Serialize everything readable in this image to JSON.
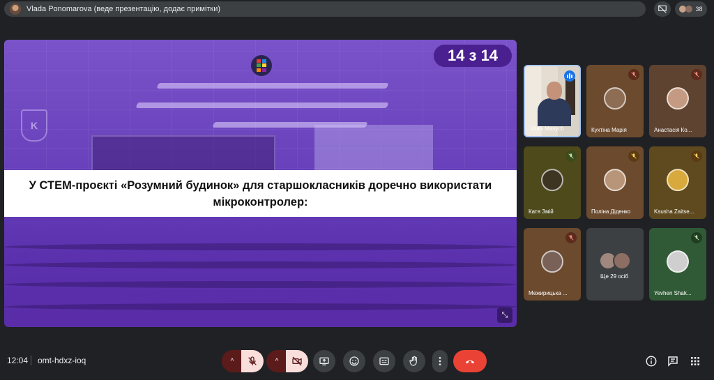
{
  "topbar": {
    "presenter_text": "Vlada Ponomarova (веде презентацію, додає примітки)",
    "participants_count": "38"
  },
  "slide": {
    "counter": "14 з 14",
    "school_logo_letters": "K",
    "question": "У СТЕМ-проєкті «Розумний будинок» для старшокласників доречно використати мікроконтролер:"
  },
  "participants": [
    {
      "name": "Vitalii Masych",
      "state": "speaking"
    },
    {
      "name": "Кухтіна Марія",
      "state": "muted"
    },
    {
      "name": "Анастасія Ко...",
      "state": "muted"
    },
    {
      "name": "Катя Змій",
      "state": "muted"
    },
    {
      "name": "Поліна Діденко",
      "state": "muted"
    },
    {
      "name": "Ksusha Zaitse...",
      "state": "muted"
    },
    {
      "name": "Межирицька ...",
      "state": "muted"
    },
    {
      "name": "Ще 29 осіб",
      "state": "group"
    },
    {
      "name": "Yevhen Shak...",
      "state": "muted"
    }
  ],
  "bottombar": {
    "time": "12:04",
    "meeting_code": "omt-hdxz-ioq"
  },
  "colors": {
    "background": "#202124",
    "end_call": "#ea4335",
    "slide_purple": "#6e47c0",
    "counter_badge": "#4a1f8f",
    "muted_red": "#f9dedc"
  },
  "icons": [
    "presentation-hide-icon",
    "people-icon",
    "mic-off-icon",
    "camera-off-icon",
    "present-screen-icon",
    "emoji-icon",
    "captions-icon",
    "raise-hand-icon",
    "more-options-icon",
    "end-call-icon",
    "info-icon",
    "chat-icon",
    "activities-icon",
    "fullscreen-exit-icon"
  ]
}
